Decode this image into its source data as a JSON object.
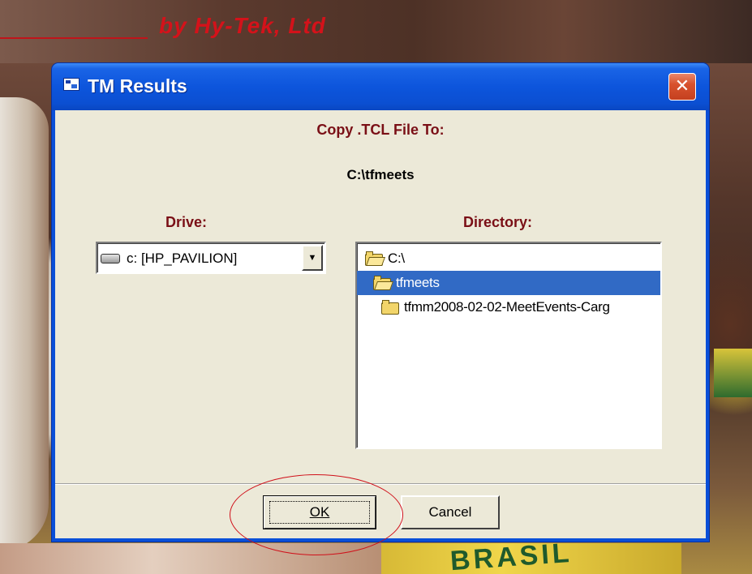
{
  "background": {
    "byline": "by Hy-Tek, Ltd",
    "jersey_text": "BRASIL"
  },
  "dialog": {
    "title": "TM Results",
    "heading": "Copy .TCL File To:",
    "current_path": "C:\\tfmeets",
    "drive_label": "Drive:",
    "directory_label": "Directory:",
    "drive_value": "c: [HP_PAVILION]",
    "directory_items": [
      {
        "label": "C:\\",
        "icon": "folder-open-icon",
        "selected": false
      },
      {
        "label": "tfmeets",
        "icon": "folder-open-icon",
        "selected": true
      },
      {
        "label": "tfmm2008-02-02-MeetEvents-Carg",
        "icon": "folder-icon",
        "selected": false
      }
    ],
    "ok_label": "OK",
    "cancel_label": "Cancel"
  },
  "colors": {
    "titlebar": "#0b4fd2",
    "label_red": "#7a0f16",
    "selection": "#316ac5",
    "annotation": "#d0101a"
  }
}
